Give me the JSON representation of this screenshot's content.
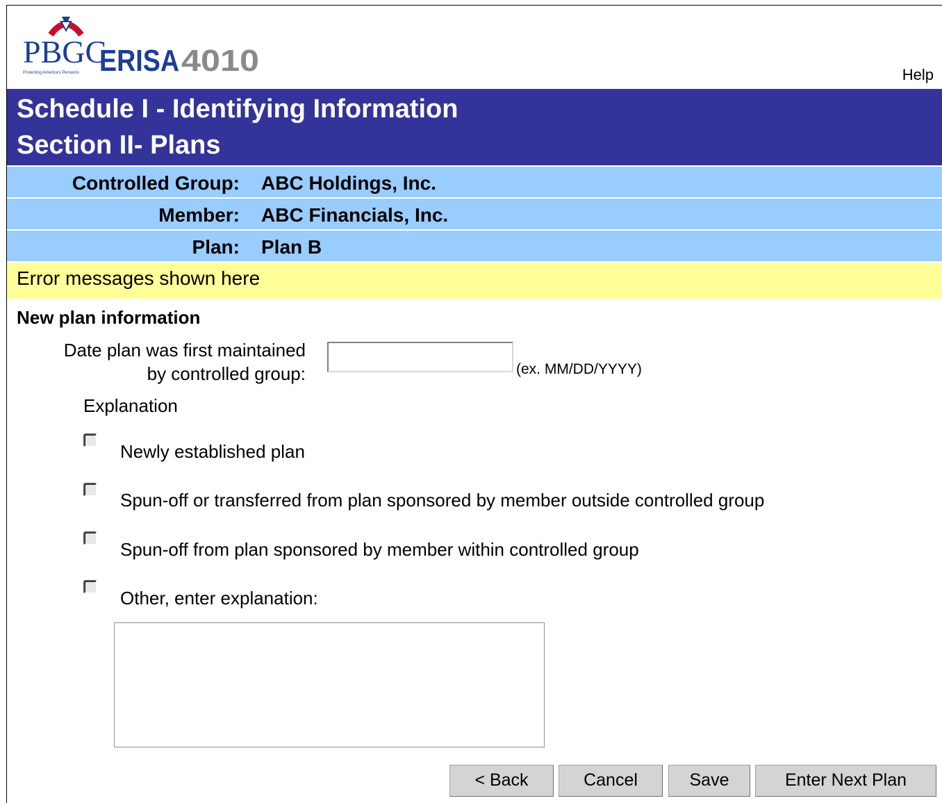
{
  "header": {
    "logo_text": "PBGC",
    "logo_subtitle": "ERISA 4010",
    "logo_tagline": "Protecting America's Pensions",
    "help_link": "Help"
  },
  "title": {
    "line1": "Schedule I - Identifying Information",
    "line2": "Section II- Plans"
  },
  "info": [
    {
      "label": "Controlled Group:",
      "value": "ABC Holdings, Inc."
    },
    {
      "label": "Member:",
      "value": "ABC Financials, Inc."
    },
    {
      "label": "Plan:",
      "value": "Plan B"
    }
  ],
  "error_message": "Error messages shown here",
  "form": {
    "section_title": "New plan information",
    "date_label_line1": "Date plan was first maintained",
    "date_label_line2": "by controlled group:",
    "date_value": "",
    "date_hint": "(ex. MM/DD/YYYY)",
    "explanation_label": "Explanation",
    "options": [
      {
        "label": "Newly established plan",
        "selected": false
      },
      {
        "label": "Spun-off or transferred from plan sponsored by member outside controlled group",
        "selected": false
      },
      {
        "label": "Spun-off from plan sponsored by member within controlled group",
        "selected": false
      },
      {
        "label": "Other, enter explanation:",
        "selected": false
      }
    ],
    "other_explanation_value": ""
  },
  "buttons": {
    "back": "< Back",
    "cancel": "Cancel",
    "save": "Save",
    "next": "Enter Next Plan"
  },
  "colors": {
    "title_bar": "#333399",
    "info_bar": "#99ccff",
    "error_bar": "#ffff99",
    "logo_blue": "#1c3f94",
    "logo_red": "#c8102e"
  }
}
